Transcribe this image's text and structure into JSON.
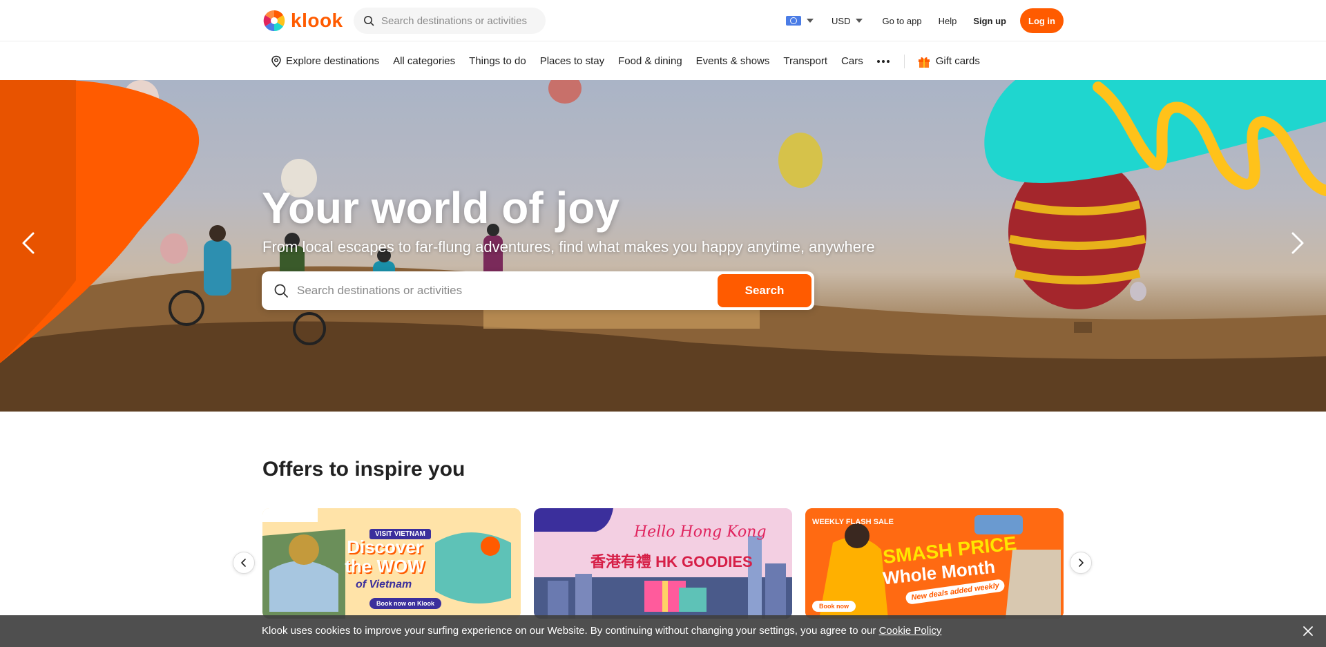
{
  "brand": {
    "name": "klook",
    "color": "#ff5b00"
  },
  "header": {
    "search_placeholder": "Search destinations or activities",
    "currency": "USD",
    "go_to_app": "Go to app",
    "help": "Help",
    "sign_up": "Sign up",
    "log_in": "Log in"
  },
  "nav": {
    "items": [
      "Explore destinations",
      "All categories",
      "Things to do",
      "Places to stay",
      "Food & dining",
      "Events & shows",
      "Transport",
      "Cars"
    ],
    "gift_cards": "Gift cards"
  },
  "hero": {
    "title": "Your world of joy",
    "subtitle": "From local escapes to far-flung adventures, find what makes you happy anytime, anywhere",
    "search_placeholder": "Search destinations or activities",
    "search_button": "Search"
  },
  "offers": {
    "title": "Offers to inspire you",
    "cards": [
      {
        "tag": "VISIT VIETNAM",
        "headline": "Discover the WOW",
        "sub": "of Vietnam",
        "cta": "Book now on Klook"
      },
      {
        "hello": "Hello Hong Kong",
        "headline": "香港有禮 HK GOODIES"
      },
      {
        "flash": "WEEKLY FLASH SALE",
        "headline": "SMASH PRICE",
        "headline2": "Whole Month",
        "tag": "New deals added weekly",
        "cta": "Book now"
      }
    ]
  },
  "cookie": {
    "text": "Klook uses cookies to improve your surfing experience on our Website. By continuing without changing your settings, you agree to our ",
    "link": "Cookie Policy"
  },
  "colors": {
    "accent": "#ff5b00",
    "hero_teal": "#1fd6cf",
    "hero_yellow": "#ffc21a"
  },
  "icons": [
    "search-icon",
    "map-pin-icon",
    "chevron-left-icon",
    "chevron-right-icon",
    "gift-icon",
    "close-icon",
    "flag-icon",
    "more-icon"
  ]
}
